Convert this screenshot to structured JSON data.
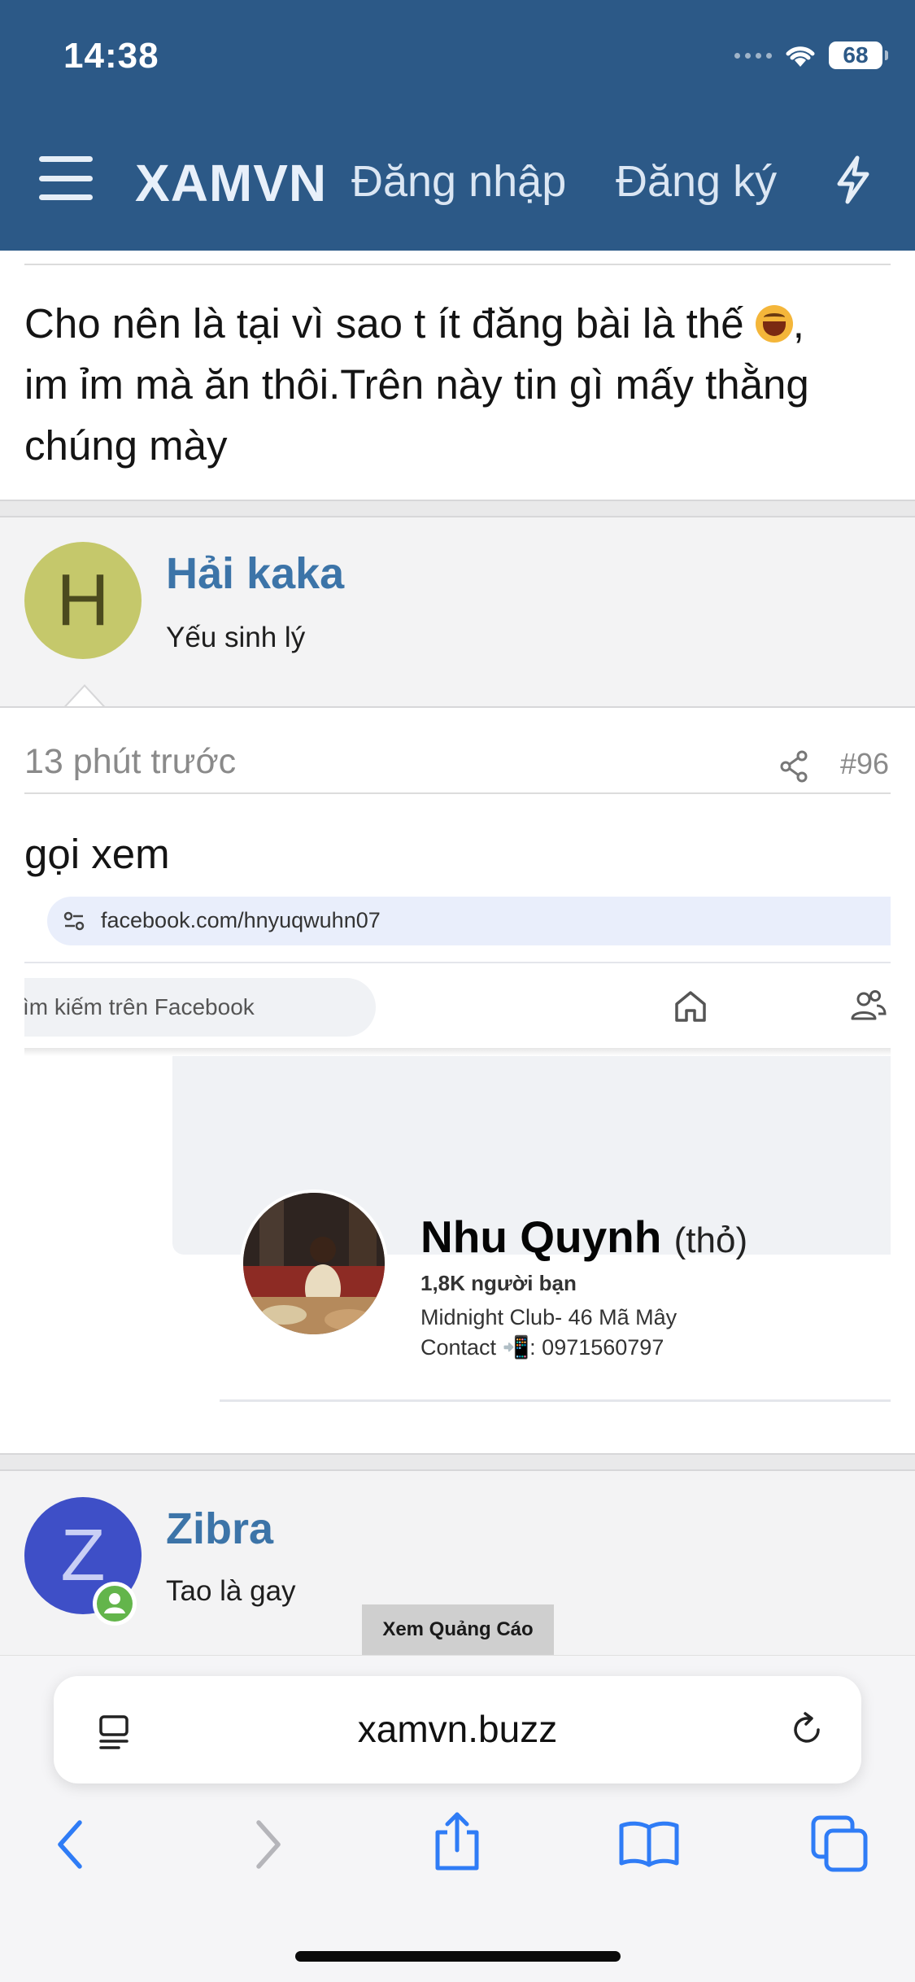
{
  "status_bar": {
    "time": "14:38",
    "battery": "68"
  },
  "nav": {
    "logo": "XAMVN",
    "login": "Đăng nhập",
    "register": "Đăng ký"
  },
  "previous_post": {
    "text_line1": "Cho nên là tại vì sao t ít đăng bài là thế",
    "text_line1_tail": ",",
    "text_line2": "im ỉm mà ăn thôi.Trên này tin gì mấy thằng",
    "text_line3": "chúng mày"
  },
  "posts": [
    {
      "author_initial": "H",
      "author_name": "Hải kaka",
      "author_title": "Yếu sinh lý",
      "avatar_color": "#c5c86b",
      "time": "13 phút trước",
      "number": "#96",
      "body": "gọi xem",
      "embedded_screenshot": {
        "url": "facebook.com/hnyuqwuhn07",
        "search_placeholder": "ìm kiếm trên Facebook",
        "profile_name": "Nhu Quynh",
        "profile_alt_name": "(thỏ)",
        "friends": "1,8K người bạn",
        "line1": "Midnight Club- 46 Mã Mây",
        "line2": "Contact 📲: 0971560797"
      }
    },
    {
      "author_initial": "Z",
      "author_name": "Zibra",
      "author_title": "Tao là gay",
      "avatar_color": "#3e4fc7"
    }
  ],
  "ad_label": "Xem Quảng Cáo",
  "browser": {
    "address": "xamvn.buzz"
  },
  "colors": {
    "header": "#2c5987",
    "author_name": "#3c74a8",
    "ios_blue": "#2f7cf6"
  }
}
